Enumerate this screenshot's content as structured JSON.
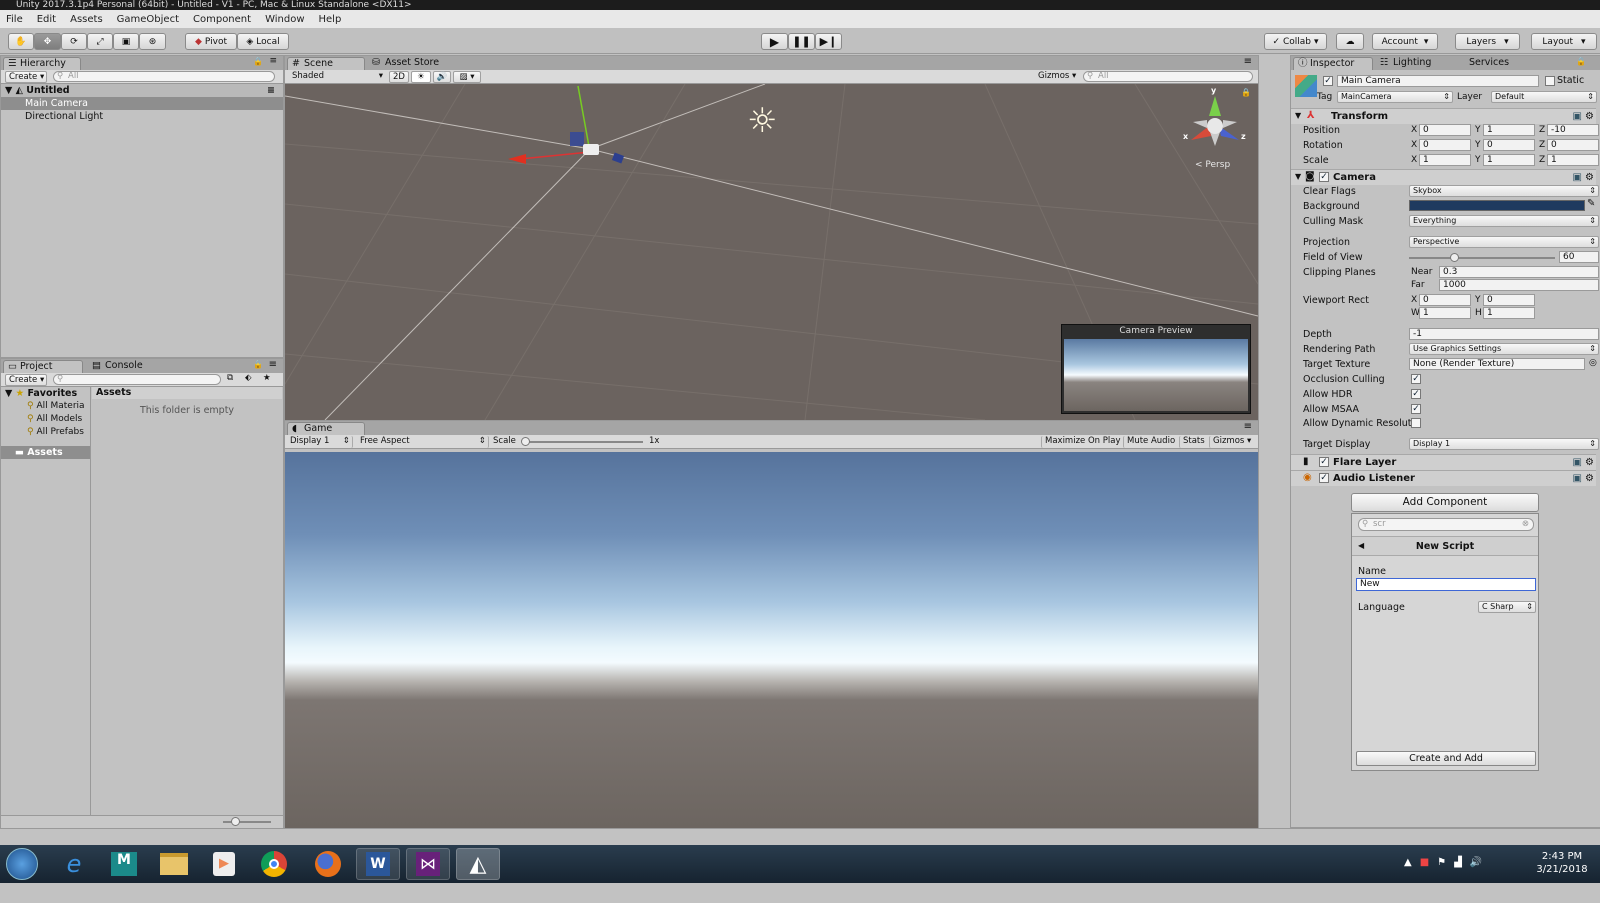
{
  "window": {
    "title": "Unity 2017.3.1p4 Personal (64bit) - Untitled - V1 - PC, Mac & Linux Standalone <DX11>"
  },
  "menu": [
    "File",
    "Edit",
    "Assets",
    "GameObject",
    "Component",
    "Window",
    "Help"
  ],
  "toolbar": {
    "pivot": "Pivot",
    "local": "Local",
    "collab": "Collab",
    "account": "Account",
    "layers": "Layers",
    "layout": "Layout"
  },
  "hierarchy": {
    "tab": "Hierarchy",
    "create": "Create",
    "search_placeholder": "All",
    "scene": "Untitled",
    "items": [
      "Main Camera",
      "Directional Light"
    ]
  },
  "project": {
    "tab": "Project",
    "console_tab": "Console",
    "create": "Create",
    "favorites": "Favorites",
    "fav_items": [
      "All Materia",
      "All Models",
      "All Prefabs"
    ],
    "assets_root": "Assets",
    "assets_header": "Assets",
    "empty_msg": "This folder is empty"
  },
  "scene": {
    "tab": "Scene",
    "asset_store_tab": "Asset Store",
    "shading": "Shaded",
    "mode2d": "2D",
    "gizmos": "Gizmos",
    "search_placeholder": "All",
    "persp": "Persp",
    "axis_x": "x",
    "axis_y": "y",
    "axis_z": "z",
    "camera_preview": "Camera Preview"
  },
  "game": {
    "tab": "Game",
    "display": "Display 1",
    "aspect": "Free Aspect",
    "scale_label": "Scale",
    "scale_value": "1x",
    "maximize": "Maximize On Play",
    "mute": "Mute Audio",
    "stats": "Stats",
    "gizmos": "Gizmos"
  },
  "inspector": {
    "tab": "Inspector",
    "lighting_tab": "Lighting",
    "services_tab": "Services",
    "object_name": "Main Camera",
    "static": "Static",
    "tag_label": "Tag",
    "tag": "MainCamera",
    "layer_label": "Layer",
    "layer": "Default",
    "transform": {
      "title": "Transform",
      "position_label": "Position",
      "rotation_label": "Rotation",
      "scale_label": "Scale",
      "position": [
        "0",
        "1",
        "-10"
      ],
      "rotation": [
        "0",
        "0",
        "0"
      ],
      "scale": [
        "1",
        "1",
        "1"
      ]
    },
    "axes": [
      "X",
      "Y",
      "Z"
    ],
    "camera": {
      "title": "Camera",
      "clear_flags_label": "Clear Flags",
      "clear_flags": "Skybox",
      "background_label": "Background",
      "background_color": "#1f3a5f",
      "culling_label": "Culling Mask",
      "culling": "Everything",
      "projection_label": "Projection",
      "projection": "Perspective",
      "fov_label": "Field of View",
      "fov": "60",
      "fov_level": 0.31,
      "clipping_label": "Clipping Planes",
      "near_label": "Near",
      "near": "0.3",
      "far_label": "Far",
      "far": "1000",
      "viewport_label": "Viewport Rect",
      "vx_label": "X",
      "vx": "0",
      "vy_label": "Y",
      "vy": "0",
      "vw_label": "W",
      "vw": "1",
      "vh_label": "H",
      "vh": "1",
      "depth_label": "Depth",
      "depth": "-1",
      "rendering_label": "Rendering Path",
      "rendering": "Use Graphics Settings",
      "target_texture_label": "Target Texture",
      "target_texture": "None (Render Texture)",
      "occlusion_label": "Occlusion Culling",
      "hdr_label": "Allow HDR",
      "msaa_label": "Allow MSAA",
      "dynres_label": "Allow Dynamic Resolut",
      "target_display_label": "Target Display",
      "target_display": "Display 1"
    },
    "flare_layer": "Flare Layer",
    "audio_listener": "Audio Listener",
    "add_component": "Add Component",
    "popup": {
      "search": "scr",
      "title": "New Script",
      "name_label": "Name",
      "name_value": "New",
      "language_label": "Language",
      "language": "C Sharp",
      "create_button": "Create and Add"
    }
  },
  "taskbar": {
    "time": "2:43 PM",
    "date": "3/21/2018"
  }
}
